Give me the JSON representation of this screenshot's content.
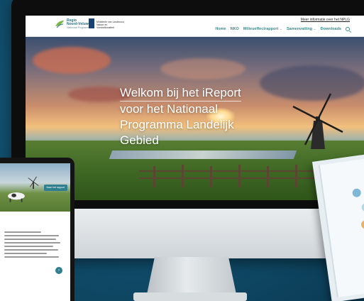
{
  "site": {
    "logo_primary": "Regio",
    "logo_secondary": "Noord-Veluwe",
    "logo_sub": "Nationaal Programma",
    "rijks_text": "Ministerie van Landbouw, Natuur en Voedselkwaliteit",
    "info_link": "Meer informatie over het NPLG",
    "nav": [
      {
        "label": "Home",
        "dropdown": false
      },
      {
        "label": "NKO",
        "dropdown": false
      },
      {
        "label": "Milieueffectrapport",
        "dropdown": true
      },
      {
        "label": "Samenvatting",
        "dropdown": true
      },
      {
        "label": "Downloads",
        "dropdown": false
      }
    ],
    "search_icon": "search-icon"
  },
  "hero": {
    "title_lines": [
      "Welkom bij het iReport",
      "voor het Nationaal",
      "Programma Landelijk",
      "Gebied"
    ]
  },
  "laptop": {
    "button_label": "Naar het rapport"
  },
  "colors": {
    "background": "#11506f",
    "accent": "#3a8b8d",
    "rijks_blue": "#154273"
  }
}
